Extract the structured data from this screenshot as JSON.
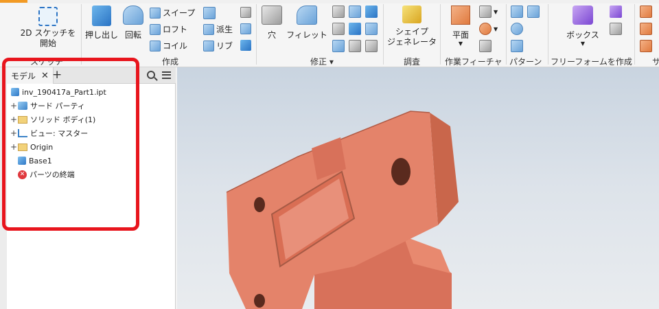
{
  "ribbon": {
    "sketch": {
      "label1": "2D スケッチを",
      "label2": "開始",
      "group": "スケッチ"
    },
    "create": {
      "extrude": "押し出し",
      "revolve": "回転",
      "sweep": "スイープ",
      "loft": "ロフト",
      "coil": "コイル",
      "derive": "派生",
      "rib": "リブ",
      "group": "作成"
    },
    "modify": {
      "hole": "穴",
      "fillet": "フィレット",
      "group": "修正 ▾"
    },
    "explore": {
      "shape_generator1": "シェイプ",
      "shape_generator2": "ジェネレータ",
      "group": "調査"
    },
    "work_features": {
      "plane": "平面",
      "group": "作業フィーチャ"
    },
    "pattern": {
      "group": "パターン"
    },
    "freeform": {
      "box": "ボックス",
      "group": "フリーフォームを作成"
    },
    "next_group": "サ"
  },
  "browser": {
    "tab_label": "モデル",
    "close": "✕",
    "add": "+",
    "tree": [
      {
        "label": "inv_190417a_Part1.ipt",
        "expander": "",
        "icon": "part-icon"
      },
      {
        "label": "サード パーティ",
        "expander": "+",
        "icon": "third-party-icon"
      },
      {
        "label": "ソリッド ボディ(1)",
        "expander": "+",
        "icon": "solid-body-folder-icon"
      },
      {
        "label": "ビュー: マスター",
        "expander": "+",
        "icon": "view-icon"
      },
      {
        "label": "Origin",
        "expander": "+",
        "icon": "folder-icon"
      },
      {
        "label": "Base1",
        "expander": "",
        "icon": "base-feature-icon"
      },
      {
        "label": "パーツの終端",
        "expander": "",
        "icon": "end-of-part-icon"
      }
    ]
  },
  "colors": {
    "highlight": "#e8151d",
    "model": "#e37c5f",
    "accent": "#f29a24"
  }
}
